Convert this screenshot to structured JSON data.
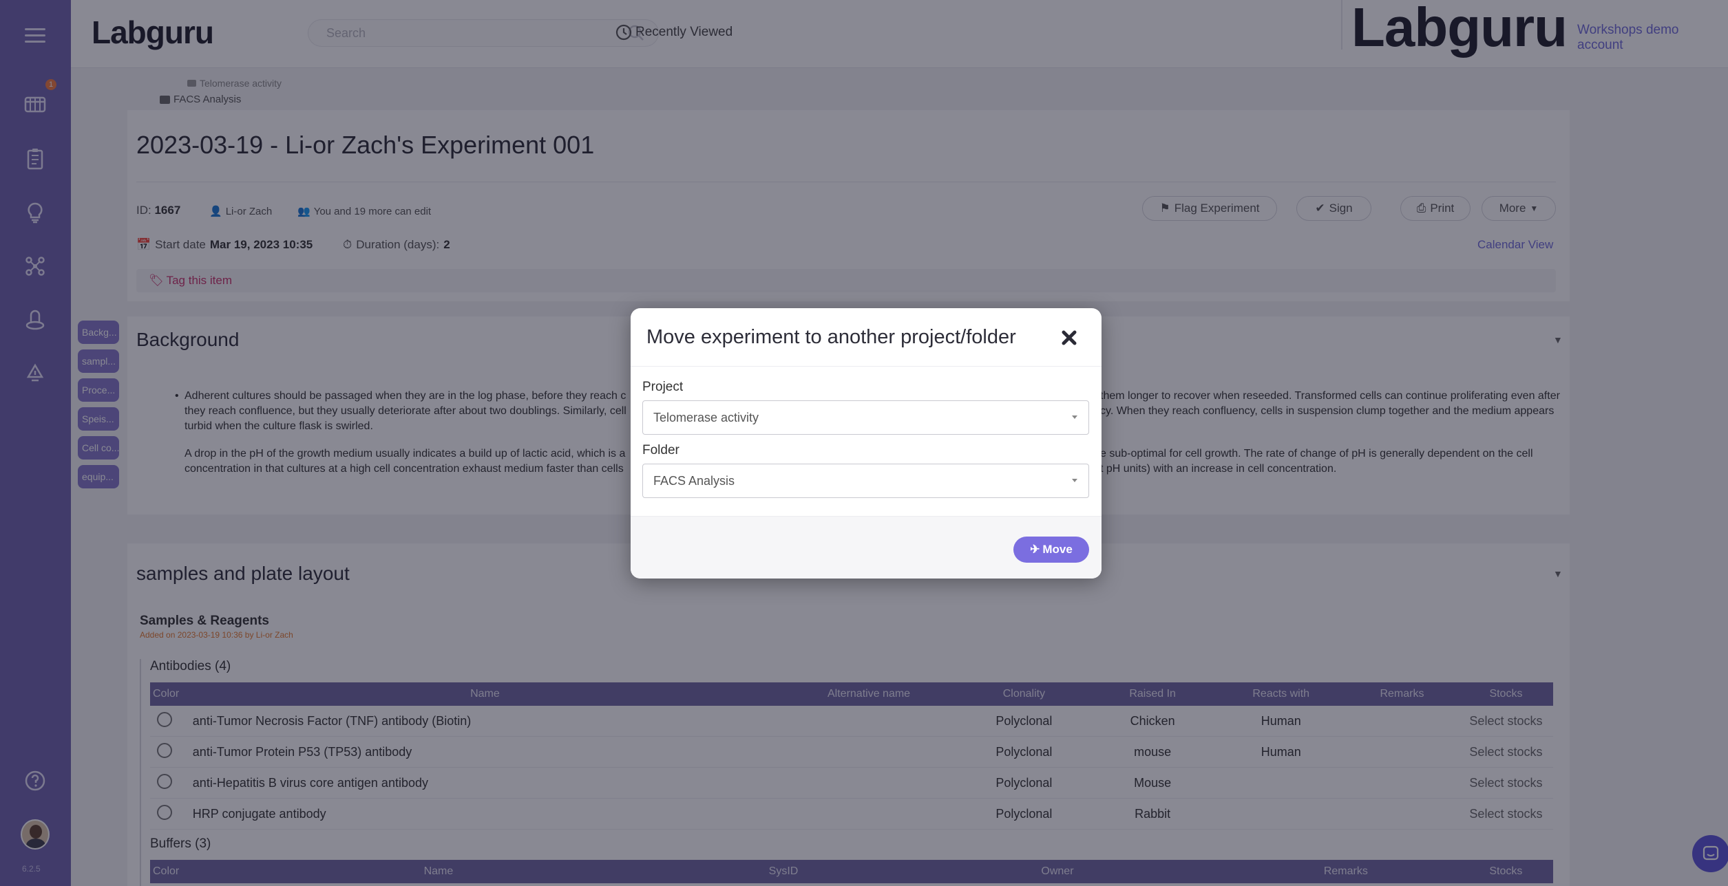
{
  "header": {
    "logo": "Labguru",
    "search_placeholder": "Search",
    "recently_viewed": "Recently Viewed",
    "brand_logo": "Labguru",
    "account": "Workshops demo account"
  },
  "sidebar": {
    "notification_count": "1",
    "version": "6.2.5"
  },
  "breadcrumb": {
    "project": "Telomerase activity",
    "folder": "FACS Analysis"
  },
  "experiment": {
    "title": "2023-03-19 - Li-or Zach's Experiment 001",
    "id_label": "ID:",
    "id_value": "1667",
    "owner": "Li-or Zach",
    "editors": "You and 19 more can edit",
    "start_label": "Start date",
    "start_value": "Mar 19, 2023 10:35",
    "duration_label": "Duration (days):",
    "duration_value": "2",
    "tag": "Tag this item",
    "calendar_view": "Calendar View",
    "buttons": {
      "flag": "Flag Experiment",
      "sign": "Sign",
      "print": "Print",
      "more": "More"
    }
  },
  "section_chips": [
    "Backg...",
    "sampl...",
    "Proce...",
    "Speis...",
    "Cell co...",
    "equip..."
  ],
  "background": {
    "title": "Background",
    "para1_left": "Adherent cultures should be passaged when they are in the log phase, before they reach c",
    "para1_right": "them longer to recover when reseeded.  Transformed cells can continue proliferating even after",
    "para1_line2_left": "they reach confluence, but they usually deteriorate after about two doublings. Similarly, cell",
    "para1_line2_right": "cy.  When they reach confluency, cells in suspension clump together and the medium appears",
    "para1_line3": "turbid when the culture flask is swirled.",
    "para2_left": "A drop in the pH of the growth medium usually indicates a build up of lactic acid, which is a",
    "para2_right": "e sub-optimal for cell growth.  The rate of change of pH is generally dependent on the cell",
    "para2_line2_left": "concentration in that cultures at a high cell concentration exhaust medium faster than cells",
    "para2_line2_right": "t pH units) with an increase in cell concentration."
  },
  "samples": {
    "title": "samples and plate layout",
    "subtitle": "Samples & Reagents",
    "added_by": "Added on 2023-03-19 10:36 by Li-or Zach",
    "antibodies_title": "Antibodies (4)",
    "antibody_headers": [
      "Color",
      "Name",
      "Alternative name",
      "Clonality",
      "Raised In",
      "Reacts with",
      "Remarks",
      "Stocks"
    ],
    "antibodies": [
      {
        "name": "anti-Tumor Necrosis Factor (TNF) antibody (Biotin)",
        "clonality": "Polyclonal",
        "raised": "Chicken",
        "reacts": "Human",
        "stocks": "Select stocks"
      },
      {
        "name": "anti-Tumor Protein P53 (TP53) antibody",
        "clonality": "Polyclonal",
        "raised": "mouse",
        "reacts": "Human",
        "stocks": "Select stocks"
      },
      {
        "name": "anti-Hepatitis B virus core antigen antibody",
        "clonality": "Polyclonal",
        "raised": "Mouse",
        "reacts": "",
        "stocks": "Select stocks"
      },
      {
        "name": "HRP conjugate antibody",
        "clonality": "Polyclonal",
        "raised": "Rabbit",
        "reacts": "",
        "stocks": "Select stocks"
      }
    ],
    "buffers_title": "Buffers (3)",
    "buffer_headers": [
      "Color",
      "Name",
      "SysID",
      "Owner",
      "Remarks",
      "Stocks"
    ]
  },
  "modal": {
    "title": "Move experiment to another project/folder",
    "project_label": "Project",
    "project_value": "Telomerase activity",
    "folder_label": "Folder",
    "folder_value": "FACS Analysis",
    "move_button": "Move"
  },
  "colors": {
    "sidebar": "#6e62ad",
    "accent": "#7b6ee0",
    "table_header": "#6f67a0",
    "tag": "#c8326a"
  }
}
